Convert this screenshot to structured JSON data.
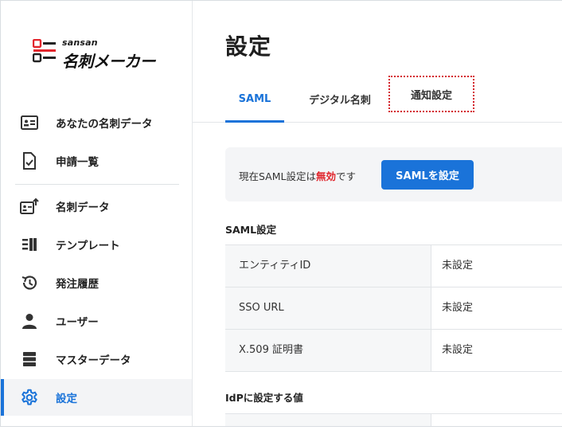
{
  "brand": {
    "small": "sansan",
    "main": "名刺メーカー"
  },
  "sidebar": {
    "items": [
      {
        "label": "あなたの名刺データ",
        "icon": "id-card-icon"
      },
      {
        "label": "申請一覧",
        "icon": "document-check-icon"
      },
      {
        "label": "名刺データ",
        "icon": "card-upload-icon"
      },
      {
        "label": "テンプレート",
        "icon": "template-icon"
      },
      {
        "label": "発注履歴",
        "icon": "history-icon"
      },
      {
        "label": "ユーザー",
        "icon": "user-icon"
      },
      {
        "label": "マスターデータ",
        "icon": "database-icon"
      },
      {
        "label": "設定",
        "icon": "gear-icon",
        "active": true
      }
    ]
  },
  "page": {
    "title": "設定"
  },
  "tabs": [
    {
      "label": "SAML",
      "active": true
    },
    {
      "label": "デジタル名刺"
    },
    {
      "label": "通知設定",
      "highlighted": true
    }
  ],
  "status": {
    "prefix": "現在SAML設定は",
    "state": "無効",
    "suffix": "です",
    "button": "SAMLを設定"
  },
  "saml_section": {
    "title": "SAML設定",
    "rows": [
      {
        "key": "エンティティID",
        "value": "未設定"
      },
      {
        "key": "SSO URL",
        "value": "未設定"
      },
      {
        "key": "X.509 証明書",
        "value": "未設定"
      }
    ]
  },
  "idp_section": {
    "title": "IdPに設定する値"
  },
  "colors": {
    "accent": "#1a73d9",
    "danger": "#e0262d",
    "highlight": "#d4242c"
  }
}
